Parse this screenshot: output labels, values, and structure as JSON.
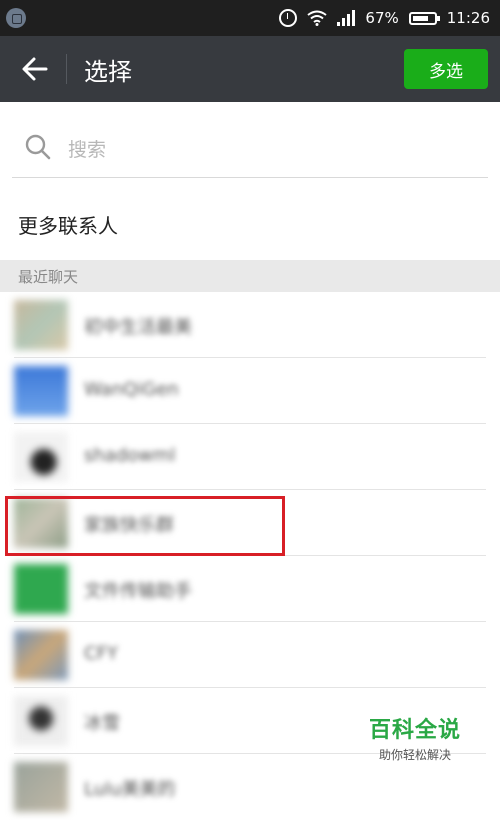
{
  "status_bar": {
    "battery_percent": "67%",
    "time": "11:26",
    "icons": [
      "app-notification-icon",
      "alarm-icon",
      "wifi-icon",
      "signal-icon",
      "battery-icon"
    ]
  },
  "toolbar": {
    "title": "选择",
    "multi_select_label": "多选",
    "accent_color": "#1aad19"
  },
  "search": {
    "placeholder": "搜索"
  },
  "more_contacts": {
    "label": "更多联系人"
  },
  "recent_section": {
    "label": "最近聊天"
  },
  "recent_chats": [
    {
      "name": "初中生活最美",
      "avatar_color": "#b9c3b4"
    },
    {
      "name": "WanQiGen",
      "avatar_color": "#4f86d6"
    },
    {
      "name": "shadowml",
      "avatar_color": "#444444"
    },
    {
      "name": "家族快乐群",
      "avatar_color": "#b3b8ad"
    },
    {
      "name": "文件传输助手",
      "avatar_color": "#3bb36b"
    },
    {
      "name": "CFY",
      "avatar_color": "#8fa9c7"
    },
    {
      "name": "冰雪",
      "avatar_color": "#777777"
    },
    {
      "name": "Lulu美美的",
      "avatar_color": "#9aa39b"
    }
  ],
  "highlight_color": "#d81f26",
  "watermark": {
    "title": "百科全说",
    "subtitle": "助你轻松解决"
  }
}
